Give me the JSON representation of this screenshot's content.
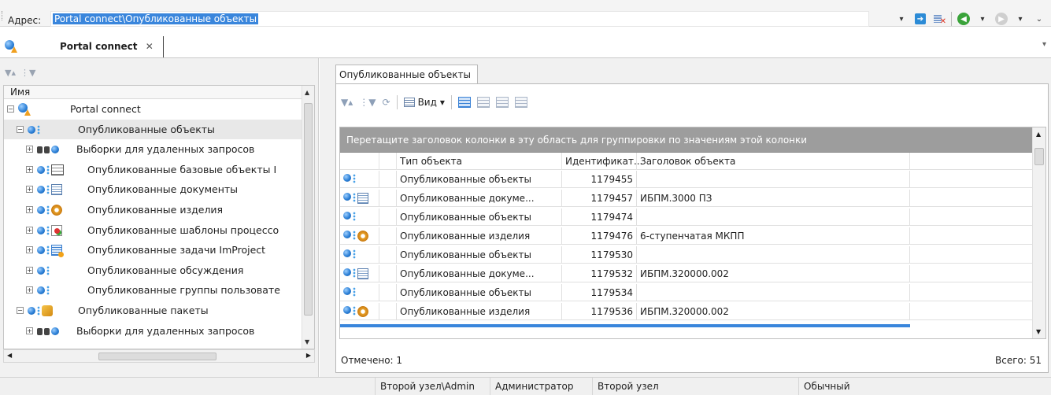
{
  "address_bar": {
    "label": "Адрес:",
    "value": "Portal connect\\Опубликованные объекты"
  },
  "doc_tab": {
    "title": "Portal connect",
    "close": "✕"
  },
  "tree": {
    "header": "Имя",
    "items": [
      {
        "label": "Portal connect",
        "expander": "−",
        "icon": "portal-connect-icon"
      },
      {
        "label": "Опубликованные объекты",
        "expander": "−",
        "icon": "published-objects-icon"
      },
      {
        "label": "Выборки для удаленных запросов",
        "expander": "+",
        "icon": "remote-query-icon"
      },
      {
        "label": "Опубликованные базовые объекты I",
        "expander": "+",
        "icon": "base-objects-table-icon"
      },
      {
        "label": "Опубликованные документы",
        "expander": "+",
        "icon": "document-icon"
      },
      {
        "label": "Опубликованные изделия",
        "expander": "+",
        "icon": "gear-product-icon"
      },
      {
        "label": "Опубликованные шаблоны процессо",
        "expander": "+",
        "icon": "workflow-template-icon"
      },
      {
        "label": "Опубликованные задачи ImProject",
        "expander": "+",
        "icon": "task-icon"
      },
      {
        "label": "Опубликованные обсуждения",
        "expander": "+",
        "icon": "discussion-icon"
      },
      {
        "label": "Опубликованные группы пользовате",
        "expander": "+",
        "icon": "user-group-icon"
      },
      {
        "label": "Опубликованные пакеты",
        "expander": "−",
        "icon": "package-icon"
      },
      {
        "label": "Выборки для удаленных запросов",
        "expander": "+",
        "icon": "remote-query-icon"
      }
    ]
  },
  "right_tab": {
    "title": "Опубликованные объекты"
  },
  "toolbar": {
    "view_label": "Вид"
  },
  "grid": {
    "group_hint": "Перетащите заголовок колонки в эту область для группировки по значениям этой колонки",
    "columns": [
      "Тип объекта",
      "Идентификат...",
      "Заголовок объекта"
    ],
    "rows": [
      {
        "icon": "published-object-icon",
        "type": "Опубликованные объекты",
        "id": "1179455",
        "title": ""
      },
      {
        "icon": "published-document-icon",
        "type": "Опубликованные докуме...",
        "id": "1179457",
        "title": "ИБПМ.3000 ПЗ"
      },
      {
        "icon": "published-object-icon",
        "type": "Опубликованные объекты",
        "id": "1179474",
        "title": ""
      },
      {
        "icon": "published-product-icon",
        "type": "Опубликованные изделия",
        "id": "1179476",
        "title": "6-ступенчатая МКПП"
      },
      {
        "icon": "published-object-icon",
        "type": "Опубликованные объекты",
        "id": "1179530",
        "title": ""
      },
      {
        "icon": "published-document-icon",
        "type": "Опубликованные докуме...",
        "id": "1179532",
        "title": "ИБПМ.320000.002"
      },
      {
        "icon": "published-object-icon",
        "type": "Опубликованные объекты",
        "id": "1179534",
        "title": ""
      },
      {
        "icon": "published-product-icon",
        "type": "Опубликованные изделия",
        "id": "1179536",
        "title": "ИБПМ.320000.002"
      }
    ]
  },
  "footer": {
    "marked": "Отмечено: 1",
    "total": "Всего: 51"
  },
  "status_bar": {
    "node_user": "Второй узел\\Admin",
    "role": "Администратор",
    "node": "Второй узел",
    "mode": "Обычный"
  },
  "colors": {
    "selection": "#3a86dc",
    "group_area": "#9d9d9d"
  }
}
